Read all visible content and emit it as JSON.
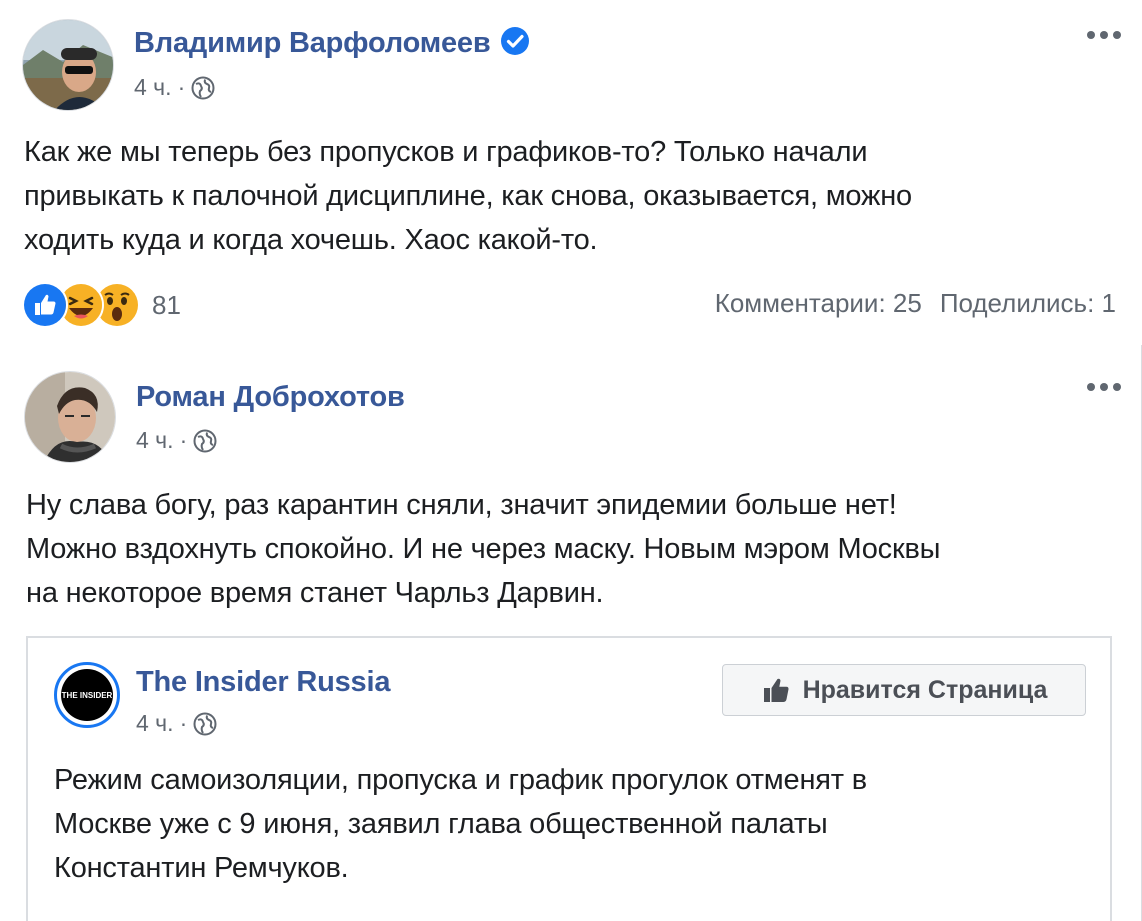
{
  "posts": [
    {
      "author": "Владимир Варфоломеев",
      "verified": true,
      "time": "4 ч.",
      "separator": "·",
      "text_lines": [
        "Как же мы теперь без пропусков и графиков-то? Только начали",
        "привыкать к палочной дисциплине, как снова, оказывается, можно",
        "ходить куда и когда хочешь. Хаос какой-то."
      ],
      "reactions": [
        "like-icon",
        "haha-icon",
        "wow-icon"
      ],
      "reaction_count": "81",
      "comments_label": "Комментарии: 25",
      "shares_label": "Поделились: 1"
    },
    {
      "author": "Роман Доброхотов",
      "time": "4 ч.",
      "separator": "·",
      "text_lines": [
        "Ну слава богу, раз карантин сняли, значит эпидемии больше нет!",
        "Можно вздохнуть спокойно. И не через маску. Новым мэром Москвы",
        "на некоторое время станет Чарльз Дарвин."
      ],
      "shared_post": {
        "author": "The Insider Russia",
        "avatar_text": "THE INSIDER",
        "time": "4 ч.",
        "separator": "·",
        "like_page_label": "Нравится Страница",
        "text_lines": [
          "Режим самоизоляции, пропуска и график прогулок отменят в",
          "Москве уже с 9 июня, заявил глава общественной палаты",
          "Константин Ремчуков."
        ]
      }
    }
  ],
  "colors": {
    "author_link": "#385898",
    "secondary_text": "#606770",
    "body_text": "#1c1e21",
    "verified_badge": "#1877f2"
  }
}
